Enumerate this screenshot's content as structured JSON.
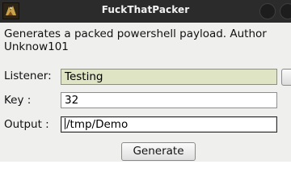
{
  "window": {
    "title": "FuckThatPacker",
    "app_icon": "app-logo-icon"
  },
  "description": "Generates a packed powershell payload. Author Unknow101",
  "form": {
    "listener_label": "Listener:",
    "listener_value": "Testing",
    "key_label": "Key :",
    "key_value": "32",
    "output_label": "Output :",
    "output_value": "/tmp/Demo"
  },
  "buttons": {
    "generate_label": "Generate"
  },
  "colors": {
    "titlebar": "#2b2b2b",
    "listener_field_bg": "#dfe4c4",
    "window_bg": "#efefee"
  }
}
